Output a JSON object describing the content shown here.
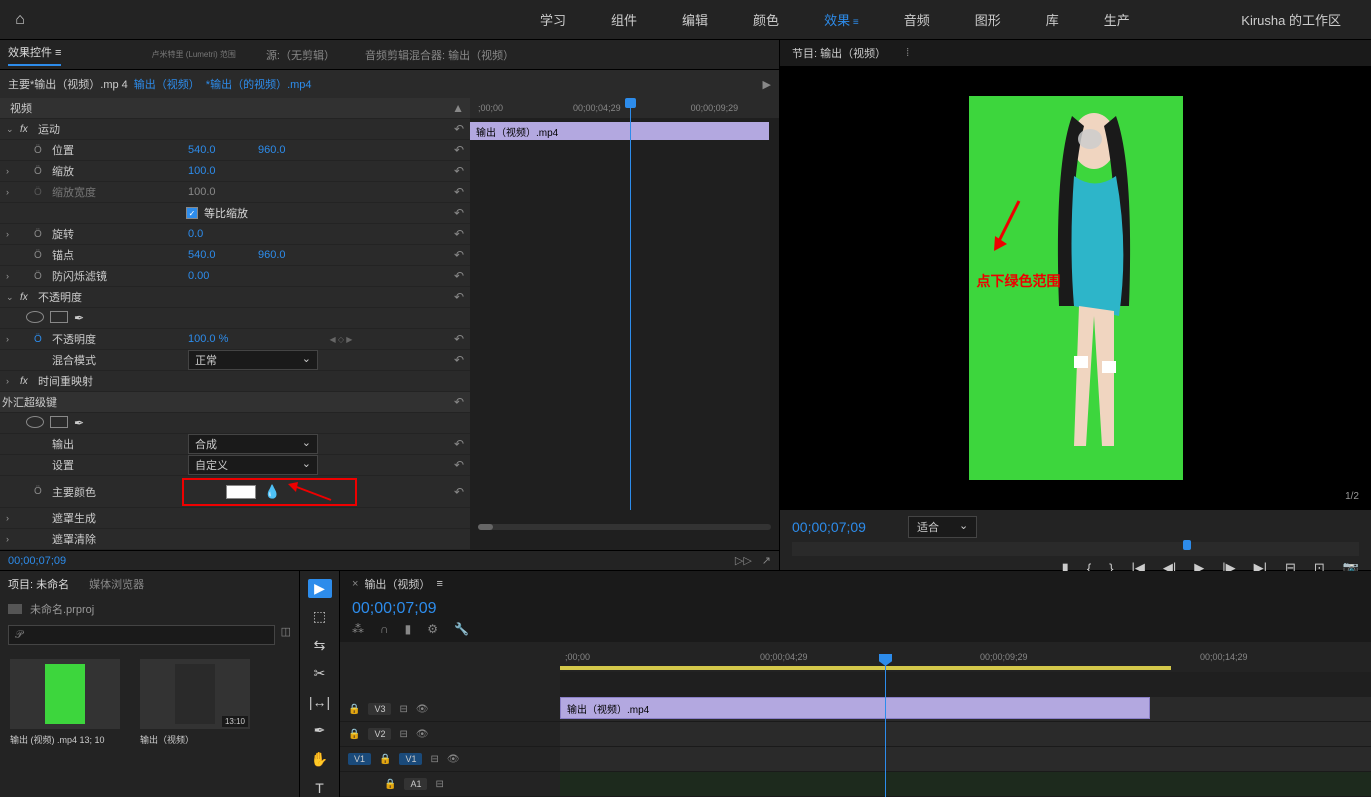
{
  "top_menu": {
    "items": [
      "学习",
      "组件",
      "编辑",
      "颜色",
      "效果",
      "音频",
      "图形",
      "库",
      "生产"
    ],
    "active_index": 4,
    "workspace": "Kirusha 的工作区"
  },
  "panel_tabs": {
    "lumetri_tag": "卢米特里 (Lumetri) 范围",
    "effect_controls": "效果控件",
    "source": "源:（无剪辑）",
    "audio_mixer": "音频剪辑混合器: 输出（视频）"
  },
  "effect_header": {
    "main": "主要*输出（视频）.mp 4",
    "link1": "输出（视频）",
    "link2": "*输出（的视频）.mp4"
  },
  "effects": {
    "video": "视频",
    "motion": {
      "label": "运动",
      "position_label": "位置",
      "position_x": "540.0",
      "position_y": "960.0",
      "scale_label": "缩放",
      "scale_val": "100.0",
      "scale_w_label": "缩放宽度",
      "scale_w_val": "100.0",
      "uniform_label": "等比缩放",
      "rotation_label": "旋转",
      "rotation_val": "0.0",
      "anchor_label": "锚点",
      "anchor_x": "540.0",
      "anchor_y": "960.0",
      "flicker_label": "防闪烁滤镜",
      "flicker_val": "0.00"
    },
    "opacity": {
      "label": "不透明度",
      "opacity_label": "不透明度",
      "opacity_val": "100.0 %",
      "blend_label": "混合模式",
      "blend_val": "正常"
    },
    "time_remap": "时间重映射",
    "ultra_key": {
      "title": "外汇超级键",
      "output_label": "输出",
      "output_val": "合成",
      "setting_label": "设置",
      "setting_val": "自定义",
      "key_color_label": "主要颜色",
      "matte_gen": "遮罩生成",
      "matte_clean": "遮罩清除"
    }
  },
  "mini_timeline": {
    "marks": [
      ";00;00",
      "00;00;04;29",
      "00;00;09;29"
    ],
    "clip_name": "输出（视频）.mp4"
  },
  "footer_timecode": "00;00;07;09",
  "program": {
    "title": "节目: 输出（视频）",
    "annotation": "点下绿色范围",
    "timecode": "00;00;07;09",
    "fit": "适合",
    "page": "1/2"
  },
  "project": {
    "tab_project": "项目: 未命名",
    "tab_media": "媒体浏览器",
    "filename": "未命名.prproj",
    "search_placeholder": "𝒫",
    "thumb1_label": "输出 (视频) .mp4 13;  10",
    "thumb2_label": "输出（视频）",
    "thumb2_time": "13:10"
  },
  "timeline": {
    "title": "输出（视频）",
    "timecode": "00;00;07;09",
    "ruler": [
      ";00;00",
      "00;00;04;29",
      "00;00;09;29",
      "00;00;14;29"
    ],
    "tracks": {
      "v3": "V3",
      "v2": "V2",
      "v1": "V1",
      "v1_src": "V1",
      "a1": "A1"
    },
    "clip_name": "输出（视频）.mp4"
  }
}
